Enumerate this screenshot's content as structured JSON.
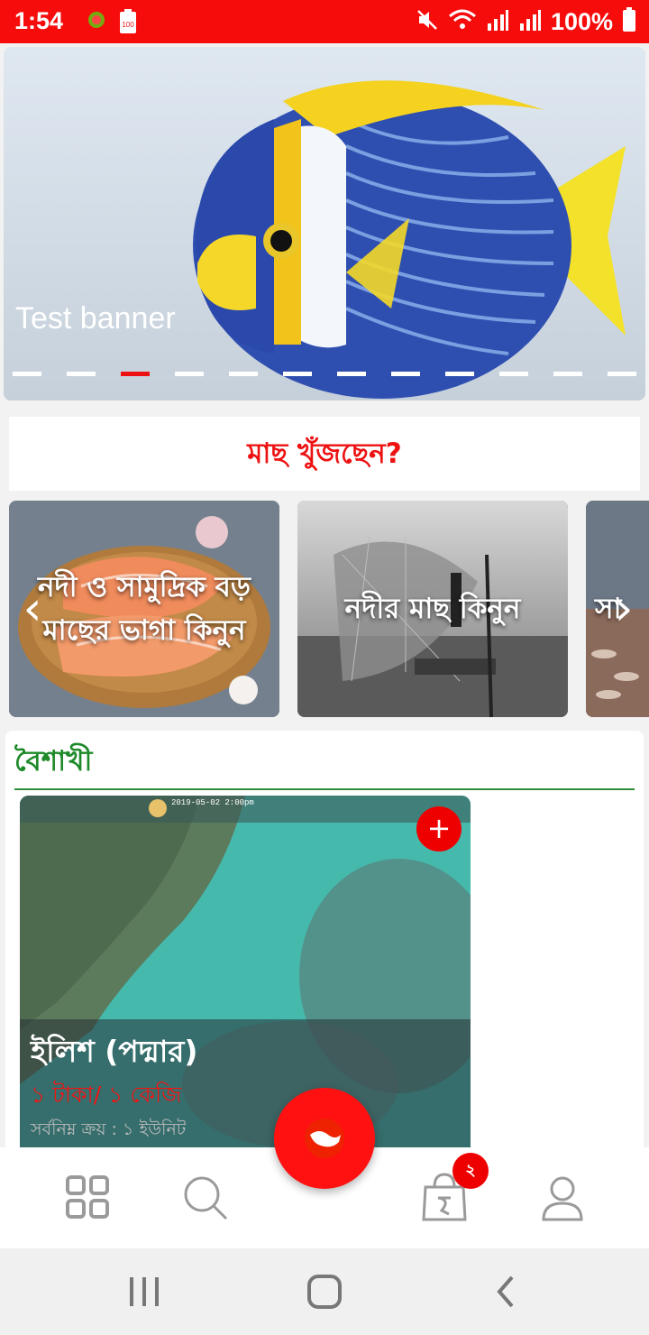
{
  "status_bar": {
    "time": "1:54",
    "battery_label": "100",
    "battery_pct": "100%",
    "icons": [
      "app-notification-icon",
      "battery-app-icon",
      "mute-icon",
      "wifi-icon",
      "signal-icon",
      "signal-icon",
      "battery-icon"
    ]
  },
  "banner": {
    "caption": "Test banner",
    "slide_count": 12,
    "active_slide": 3
  },
  "search_prompt": "মাছ খুঁজছেন?",
  "categories": [
    {
      "label": "নদী ও সামুদ্রিক বড় মাছের ভাগা কিনুন"
    },
    {
      "label": "নদীর মাছ কিনুন"
    },
    {
      "label": "সা"
    }
  ],
  "section": {
    "title": "বৈশাখী",
    "product": {
      "name": "ইলিশ (পদ্মার)",
      "price": "১ টাকা/ ১ কেজি",
      "min_purchase": "সর্বনিম্ন ক্রয় : ১ ইউনিট",
      "add_label": "+",
      "map_timestamp": "2019-05-02 2:00pm"
    }
  },
  "bottom_nav": {
    "items": [
      "grid-icon",
      "search-icon",
      "fish-icon",
      "cart-icon",
      "profile-icon"
    ],
    "cart_badge": "২"
  },
  "colors": {
    "primary_red": "#f70c0c",
    "section_green": "#1e8a2a"
  }
}
